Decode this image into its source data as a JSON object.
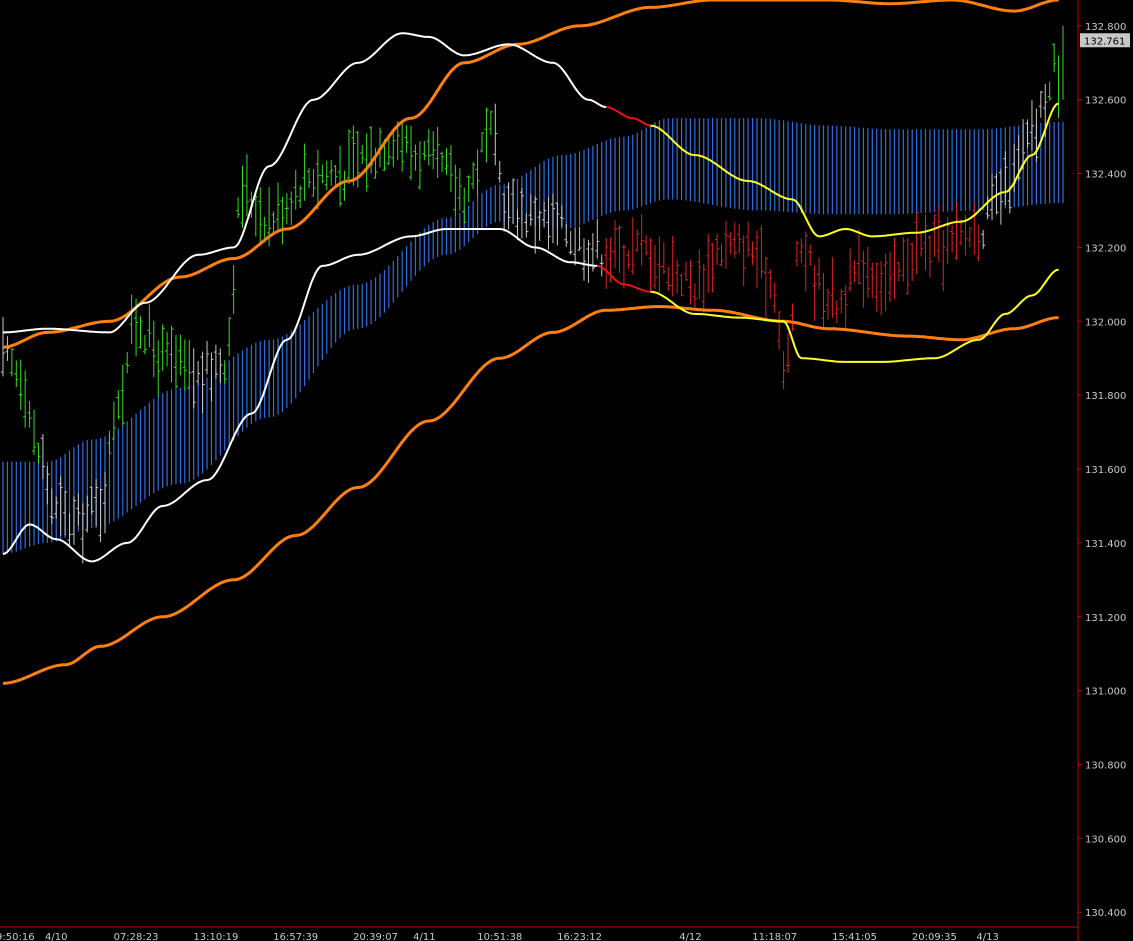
{
  "chart_data": {
    "type": "candlestick",
    "title": "",
    "ylim": [
      130.36,
      132.87
    ],
    "grid": false,
    "background": "#000000",
    "colors": {
      "up_bars": "#33dd22",
      "down_bars": "#dd2222",
      "neutral_bars": "#c8c8c8",
      "cloud": "#2f6fe0",
      "outer_band": "#ff7f11",
      "white_line": "#ffffff",
      "yellow_line": "#ffff22",
      "red_segment": "#ee1111",
      "axis": "#cc0000"
    },
    "y_ticks": [
      "132.800",
      "132.600",
      "132.400",
      "132.200",
      "132.000",
      "131.800",
      "131.600",
      "131.400",
      "131.200",
      "131.000",
      "130.800",
      "130.600",
      "130.400"
    ],
    "x_tick_labels": [
      {
        "label": "9:50:16",
        "index": 0
      },
      {
        "label": "4/10",
        "index": 12
      },
      {
        "label": "07:28:23",
        "index": 30
      },
      {
        "label": "13:10:19",
        "index": 48
      },
      {
        "label": "16:57:39",
        "index": 66
      },
      {
        "label": "20:39:07",
        "index": 84
      },
      {
        "label": "4/11",
        "index": 95
      },
      {
        "label": "10:51:38",
        "index": 112
      },
      {
        "label": "16:23:12",
        "index": 130
      },
      {
        "label": "4/12",
        "index": 155
      },
      {
        "label": "11:18:07",
        "index": 174
      },
      {
        "label": "15:41:05",
        "index": 192
      },
      {
        "label": "20:09:35",
        "index": 210
      },
      {
        "label": "4/13",
        "index": 222
      }
    ],
    "last_price": "132.761",
    "bar_count": 240,
    "series": [
      {
        "kind": "price_bars",
        "points": [
          [
            0,
            131.9
          ],
          [
            4,
            131.86
          ],
          [
            8,
            131.65
          ],
          [
            12,
            131.48
          ],
          [
            16,
            131.45
          ],
          [
            22,
            131.5
          ],
          [
            26,
            131.8
          ],
          [
            30,
            132.0
          ],
          [
            36,
            131.9
          ],
          [
            44,
            131.85
          ],
          [
            50,
            131.9
          ],
          [
            54,
            132.35
          ],
          [
            60,
            132.28
          ],
          [
            70,
            132.4
          ],
          [
            76,
            132.4
          ],
          [
            82,
            132.45
          ],
          [
            88,
            132.5
          ],
          [
            94,
            132.45
          ],
          [
            98,
            132.42
          ],
          [
            104,
            132.35
          ],
          [
            110,
            132.5
          ],
          [
            114,
            132.3
          ],
          [
            120,
            132.28
          ],
          [
            126,
            132.25
          ],
          [
            132,
            132.2
          ],
          [
            138,
            132.18
          ],
          [
            144,
            132.2
          ],
          [
            150,
            132.15
          ],
          [
            156,
            132.1
          ],
          [
            162,
            132.2
          ],
          [
            168,
            132.2
          ],
          [
            174,
            132.1
          ],
          [
            176,
            131.85
          ],
          [
            180,
            132.2
          ],
          [
            184,
            132.1
          ],
          [
            188,
            132.05
          ],
          [
            194,
            132.15
          ],
          [
            200,
            132.1
          ],
          [
            206,
            132.2
          ],
          [
            212,
            132.2
          ],
          [
            220,
            132.25
          ],
          [
            226,
            132.35
          ],
          [
            232,
            132.5
          ],
          [
            236,
            132.62
          ],
          [
            238,
            132.76
          ]
        ]
      },
      {
        "kind": "outer_band_upper",
        "points": [
          [
            0,
            131.93
          ],
          [
            10,
            131.97
          ],
          [
            24,
            132.0
          ],
          [
            40,
            132.12
          ],
          [
            52,
            132.17
          ],
          [
            64,
            132.25
          ],
          [
            78,
            132.38
          ],
          [
            92,
            132.55
          ],
          [
            104,
            132.7
          ],
          [
            116,
            132.75
          ],
          [
            130,
            132.8
          ],
          [
            146,
            132.85
          ],
          [
            160,
            132.87
          ],
          [
            186,
            132.87
          ],
          [
            200,
            132.86
          ],
          [
            214,
            132.87
          ],
          [
            228,
            132.84
          ],
          [
            238,
            132.87
          ]
        ]
      },
      {
        "kind": "outer_band_lower",
        "points": [
          [
            0,
            131.02
          ],
          [
            14,
            131.07
          ],
          [
            22,
            131.12
          ],
          [
            36,
            131.2
          ],
          [
            52,
            131.3
          ],
          [
            66,
            131.42
          ],
          [
            80,
            131.55
          ],
          [
            96,
            131.73
          ],
          [
            112,
            131.9
          ],
          [
            124,
            131.97
          ],
          [
            136,
            132.03
          ],
          [
            148,
            132.04
          ],
          [
            160,
            132.03
          ],
          [
            176,
            132.0
          ],
          [
            186,
            131.98
          ],
          [
            204,
            131.96
          ],
          [
            216,
            131.95
          ],
          [
            228,
            131.98
          ],
          [
            238,
            132.01
          ]
        ]
      },
      {
        "kind": "white_line",
        "points": [
          [
            0,
            131.37
          ],
          [
            6,
            131.45
          ],
          [
            12,
            131.41
          ],
          [
            20,
            131.35
          ],
          [
            28,
            131.4
          ],
          [
            36,
            131.5
          ],
          [
            46,
            131.57
          ],
          [
            56,
            131.75
          ],
          [
            64,
            131.95
          ],
          [
            72,
            132.15
          ],
          [
            80,
            132.18
          ],
          [
            92,
            132.23
          ],
          [
            100,
            132.25
          ],
          [
            112,
            132.25
          ],
          [
            120,
            132.2
          ],
          [
            128,
            132.16
          ],
          [
            134,
            132.15
          ]
        ]
      },
      {
        "kind": "white_line_upper",
        "points": [
          [
            0,
            131.97
          ],
          [
            10,
            131.98
          ],
          [
            24,
            131.97
          ],
          [
            32,
            132.05
          ],
          [
            44,
            132.18
          ],
          [
            52,
            132.2
          ],
          [
            60,
            132.42
          ],
          [
            70,
            132.6
          ],
          [
            80,
            132.7
          ],
          [
            90,
            132.78
          ],
          [
            96,
            132.77
          ],
          [
            104,
            132.72
          ],
          [
            114,
            132.75
          ],
          [
            124,
            132.7
          ],
          [
            132,
            132.6
          ],
          [
            136,
            132.58
          ]
        ]
      },
      {
        "kind": "red_segment",
        "points": [
          [
            136,
            132.58
          ],
          [
            142,
            132.55
          ],
          [
            146,
            132.53
          ]
        ]
      },
      {
        "kind": "red_segment_lower",
        "points": [
          [
            134,
            132.15
          ],
          [
            140,
            132.1
          ],
          [
            146,
            132.08
          ]
        ]
      },
      {
        "kind": "yellow_line_upper",
        "points": [
          [
            146,
            132.53
          ],
          [
            156,
            132.45
          ],
          [
            168,
            132.38
          ],
          [
            178,
            132.33
          ],
          [
            184,
            132.23
          ],
          [
            190,
            132.25
          ],
          [
            196,
            132.23
          ],
          [
            206,
            132.24
          ],
          [
            216,
            132.27
          ],
          [
            226,
            132.35
          ],
          [
            232,
            132.45
          ],
          [
            238,
            132.59
          ]
        ]
      },
      {
        "kind": "yellow_line_lower",
        "points": [
          [
            146,
            132.08
          ],
          [
            156,
            132.02
          ],
          [
            166,
            132.01
          ],
          [
            176,
            132.0
          ],
          [
            180,
            131.9
          ],
          [
            190,
            131.89
          ],
          [
            198,
            131.89
          ],
          [
            210,
            131.9
          ],
          [
            220,
            131.95
          ],
          [
            226,
            132.02
          ],
          [
            232,
            132.07
          ],
          [
            238,
            132.14
          ]
        ]
      },
      {
        "kind": "cloud_upper",
        "points": [
          [
            0,
            131.62
          ],
          [
            10,
            131.62
          ],
          [
            20,
            131.68
          ],
          [
            40,
            131.82
          ],
          [
            60,
            131.95
          ],
          [
            80,
            132.1
          ],
          [
            100,
            132.28
          ],
          [
            112,
            132.37
          ],
          [
            126,
            132.45
          ],
          [
            140,
            132.5
          ],
          [
            150,
            132.55
          ],
          [
            170,
            132.55
          ],
          [
            186,
            132.53
          ],
          [
            200,
            132.52
          ],
          [
            220,
            132.52
          ],
          [
            238,
            132.54
          ]
        ]
      },
      {
        "kind": "cloud_lower",
        "points": [
          [
            0,
            131.37
          ],
          [
            10,
            131.4
          ],
          [
            20,
            131.44
          ],
          [
            40,
            131.56
          ],
          [
            60,
            131.74
          ],
          [
            80,
            131.98
          ],
          [
            100,
            132.18
          ],
          [
            112,
            132.27
          ],
          [
            126,
            132.25
          ],
          [
            140,
            132.3
          ],
          [
            150,
            132.33
          ],
          [
            170,
            132.3
          ],
          [
            186,
            132.29
          ],
          [
            200,
            132.29
          ],
          [
            220,
            132.3
          ],
          [
            238,
            132.32
          ]
        ]
      }
    ]
  }
}
